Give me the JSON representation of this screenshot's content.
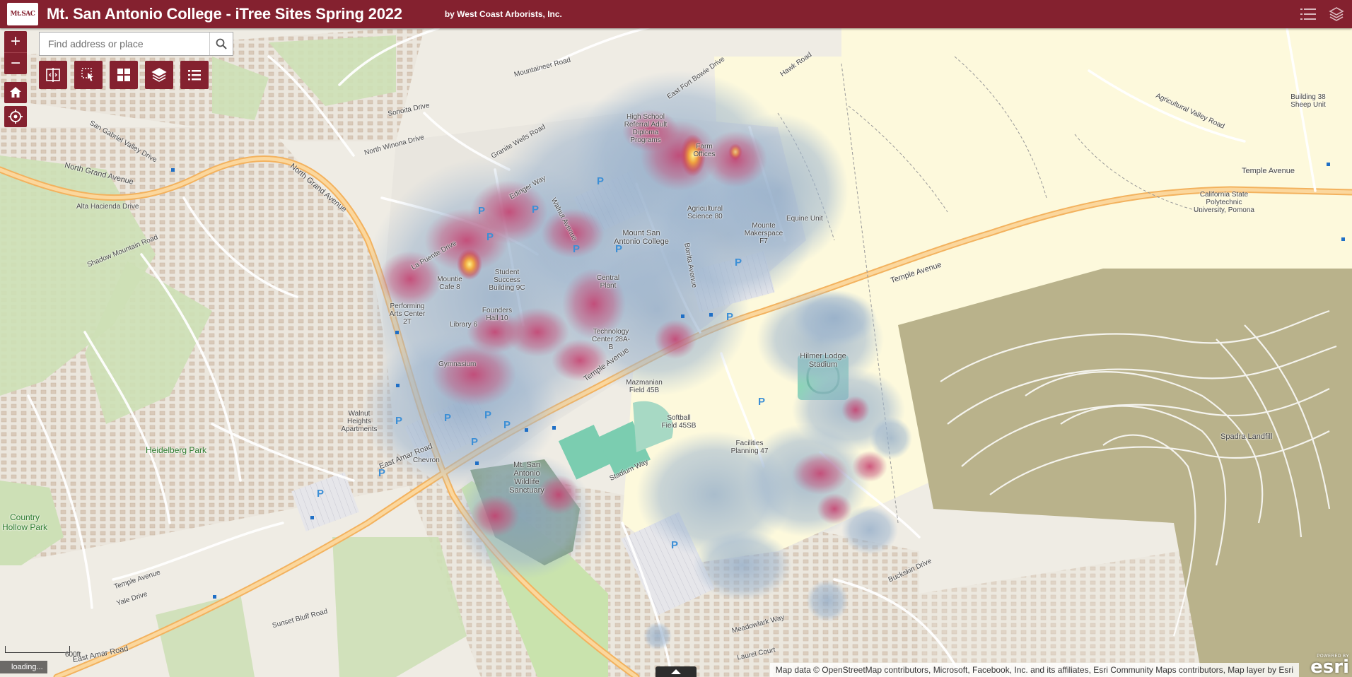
{
  "header": {
    "logo_text": "Mt.SAC",
    "title": "Mt. San Antonio College - iTree Sites Spring 2022",
    "subtitle": "by West Coast Arborists, Inc.",
    "color": "#84212f"
  },
  "controls": {
    "zoom_in": "+",
    "zoom_out": "−",
    "home_icon": "home-icon",
    "locate_icon": "locate-icon"
  },
  "search": {
    "placeholder": "Find address or place",
    "value": ""
  },
  "toolbar": [
    {
      "name": "swipe-tool",
      "icon": "split-screen-icon"
    },
    {
      "name": "measure-tool",
      "icon": "pointer-hand-icon"
    },
    {
      "name": "basemap-gallery-tool",
      "icon": "grid-icon"
    },
    {
      "name": "layer-list-tool",
      "icon": "layers-icon"
    },
    {
      "name": "legend-tool",
      "icon": "list-icon"
    }
  ],
  "map": {
    "labels": {
      "north_grand_1": "North Grand Avenue",
      "north_grand_2": "North Grand Avenue",
      "san_gabriel": "San Gabriel Valley Drive",
      "alta_hacienda": "Alta Hacienda Drive",
      "shadow_mountain": "Shadow Mountain Road",
      "mountaineer": "Mountaineer Road",
      "sonoita": "Sonoita Drive",
      "north_winona": "North Winona Drive",
      "granite_wells": "Granite Wells Road",
      "east_fort_bowie": "East Fort Bowie Drive",
      "la_puente": "La Puente Drive",
      "edinger": "Edinger Way",
      "walnut_ave": "Walnut Avenue",
      "bonita_ave": "Bonita Avenue",
      "temple_1": "Temple Avenue",
      "temple_2": "Temple Avenue",
      "temple_3": "Temple Avenue",
      "temple_4": "Temple Avenue",
      "east_amar_1": "East Amar Road",
      "east_amar_2": "East Amar Road",
      "mt_sac_label": "Mount San Antonio College",
      "hilmer": "Hilmer Lodge Stadium",
      "mazmanian": "Mazmanian Field 45B",
      "softball": "Softball Field 45SB",
      "facilities": "Facilities Planning 47",
      "wildlife": "Mt. San Antonio Wildlife Sanctuary",
      "heidelberg": "Heidelberg Park",
      "country_hollow": "Country Hollow Park",
      "walnut_heights": "Walnut Heights Apartments",
      "chevron": "Chevron",
      "spadra": "Spadra Landfill",
      "cal_poly": "California State Polytechnic University, Pomona",
      "building38": "Building 38 Sheep Unit",
      "agricultural_valley": "Agricultural Valley Road",
      "farm_offices": "Farm Offices",
      "high_school": "High School Referral Adult Diploma Programs",
      "ag_science": "Agricultural Science 80",
      "makerspace": "Mounte Makerspace F7",
      "equine": "Equine Unit",
      "central_plant": "Central Plant",
      "technology_center": "Technology Center 28A-B",
      "library": "Library 6",
      "gymnasium": "Gymnasium",
      "performing_arts": "Performing Arts Center 2T",
      "founders": "Founders Hall 10",
      "student_success": "Student Success Building 9C",
      "mountie_cafe": "Mountie Cafe 8",
      "temple_lower": "Temple Avenue",
      "yale_drive": "Yale Drive",
      "sunset_bluff": "Sunset Bluff Road",
      "stadium_way": "Stadium Way",
      "meadowlark": "Meadowlark Way",
      "laurel_court": "Laurel Court",
      "buckskin": "Buckskin Drive",
      "hawk_road": "Hawk Road"
    }
  },
  "scale": {
    "label": "600ft"
  },
  "status": {
    "loading": "loading..."
  },
  "attribution": {
    "text": "Map data © OpenStreetMap contributors, Microsoft, Facebook, Inc. and its affiliates, Esri Community Maps contributors, Map layer by Esri"
  },
  "esri": {
    "powered": "POWERED BY",
    "mark": "esri"
  }
}
